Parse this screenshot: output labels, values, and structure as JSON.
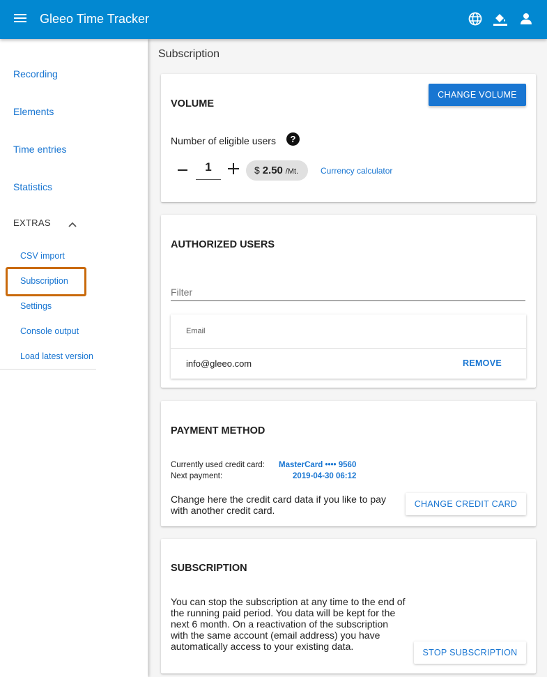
{
  "app": {
    "title": "Gleeo Time Tracker"
  },
  "appbar": {
    "icons": [
      "menu-icon",
      "globe-icon",
      "paint-bucket-icon",
      "account-icon"
    ]
  },
  "sidebar": {
    "items": [
      {
        "label": "Recording"
      },
      {
        "label": "Elements"
      },
      {
        "label": "Time entries"
      },
      {
        "label": "Statistics"
      }
    ],
    "extras_label": "EXTRAS",
    "extras_items": [
      {
        "label": "CSV import"
      },
      {
        "label": "Subscription"
      },
      {
        "label": "Settings"
      },
      {
        "label": "Console output"
      },
      {
        "label": "Load latest version"
      }
    ]
  },
  "main": {
    "page_title": "Subscription",
    "volume": {
      "title": "VOLUME",
      "change_button": "CHANGE VOLUME",
      "eligible_label": "Number of eligible users",
      "quantity": "1",
      "currency_symbol": "$",
      "price": "2.50",
      "price_unit": "/Mt.",
      "currency_link": "Currency calculator"
    },
    "authorized_users": {
      "title": "AUTHORIZED USERS",
      "filter_label": "Filter",
      "column_email": "Email",
      "rows": [
        {
          "email": "info@gleeo.com",
          "action": "REMOVE"
        }
      ]
    },
    "payment": {
      "title": "PAYMENT METHOD",
      "card_label": "Currently used credit card:",
      "card_value": "MasterCard •••• 9560",
      "next_label": "Next payment:",
      "next_value": "2019-04-30 06:12",
      "description": "Change here the credit card data if you like to pay with another credit card.",
      "change_button": "CHANGE CREDIT CARD"
    },
    "subscription": {
      "title": "SUBSCRIPTION",
      "description": "You can stop the subscription at any time to the end of the running paid period. You data will be kept for the next 6 month. On a reactivation of the subscription with the same account (email address) you have automatically access to your existing data.",
      "stop_button": "STOP SUBSCRIPTION"
    }
  },
  "colors": {
    "appbar": "#0288d1",
    "primary": "#1976d2",
    "highlight": "#c96a0c"
  }
}
